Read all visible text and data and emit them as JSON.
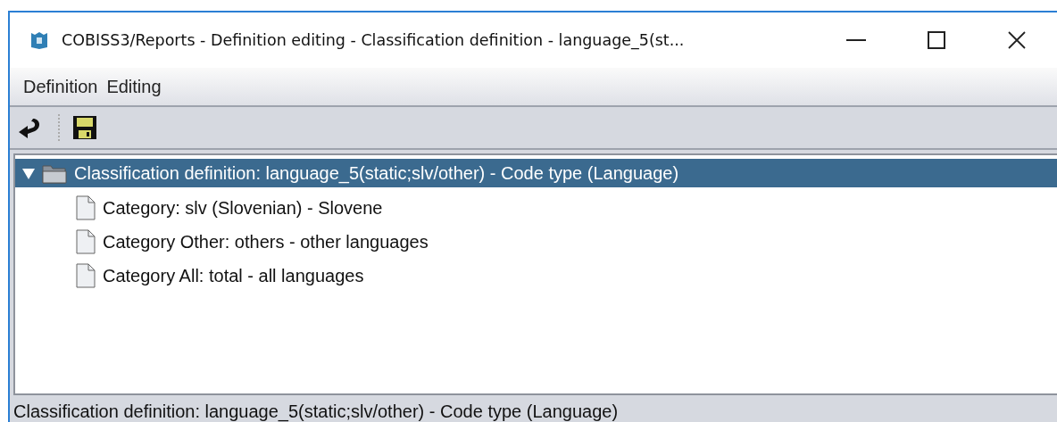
{
  "window": {
    "title": "COBISS3/Reports - Definition editing - Classification definition - language_5(st..."
  },
  "menu": [
    "Definition",
    "Editing"
  ],
  "tree": [
    {
      "label": "Classification definition: language_5(static;slv/other) - Code type (Language)",
      "kind": "folder",
      "selected": true,
      "expanded": true,
      "children": [
        {
          "label": "Category: slv (Slovenian) - Slovene",
          "kind": "document",
          "selected": false
        },
        {
          "label": "Category Other: others - other languages",
          "kind": "document",
          "selected": false
        },
        {
          "label": "Category All: total - all languages",
          "kind": "document",
          "selected": false
        }
      ]
    }
  ],
  "status_bar": "Classification definition: language_5(static;slv/other) - Code type (Language)"
}
